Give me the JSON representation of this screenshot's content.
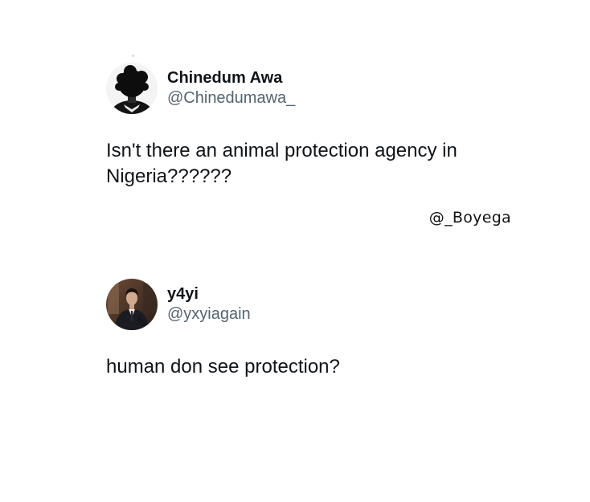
{
  "tweets": [
    {
      "display_name": "Chinedum Awa",
      "handle": "@Chinedumawa_",
      "text": "Isn't there an animal protection agency in\nNigeria??????",
      "avatar_icon": "dark-hair-avatar-icon"
    },
    {
      "display_name": "y4yi",
      "handle": "@yxyiagain",
      "text": "human don see protection?",
      "avatar_icon": "suited-man-photo-avatar-icon"
    }
  ],
  "watermark": {
    "text": "@_Boyega"
  },
  "colors": {
    "text": "#0f1419",
    "handle": "#536471",
    "background": "#ffffff"
  }
}
